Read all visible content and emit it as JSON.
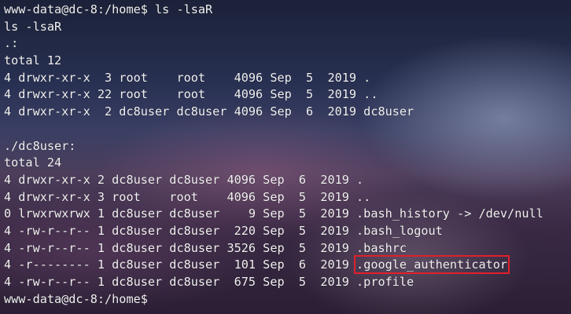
{
  "terminal": {
    "lines": [
      {
        "pre": "www-data@dc-8:/home$ ls -lsaR",
        "hl": "",
        "post": ""
      },
      {
        "pre": "ls -lsaR",
        "hl": "",
        "post": ""
      },
      {
        "pre": ".:",
        "hl": "",
        "post": ""
      },
      {
        "pre": "total 12",
        "hl": "",
        "post": ""
      },
      {
        "pre": "4 drwxr-xr-x  3 root    root    4096 Sep  5  2019 .",
        "hl": "",
        "post": ""
      },
      {
        "pre": "4 drwxr-xr-x 22 root    root    4096 Sep  5  2019 ..",
        "hl": "",
        "post": ""
      },
      {
        "pre": "4 drwxr-xr-x  2 dc8user dc8user 4096 Sep  6  2019 dc8user",
        "hl": "",
        "post": ""
      },
      {
        "pre": "",
        "hl": "",
        "post": ""
      },
      {
        "pre": "./dc8user:",
        "hl": "",
        "post": ""
      },
      {
        "pre": "total 24",
        "hl": "",
        "post": ""
      },
      {
        "pre": "4 drwxr-xr-x 2 dc8user dc8user 4096 Sep  6  2019 .",
        "hl": "",
        "post": ""
      },
      {
        "pre": "4 drwxr-xr-x 3 root    root    4096 Sep  5  2019 ..",
        "hl": "",
        "post": ""
      },
      {
        "pre": "0 lrwxrwxrwx 1 dc8user dc8user    9 Sep  5  2019 .bash_history -> /dev/null",
        "hl": "",
        "post": ""
      },
      {
        "pre": "4 -rw-r--r-- 1 dc8user dc8user  220 Sep  5  2019 .bash_logout",
        "hl": "",
        "post": ""
      },
      {
        "pre": "4 -rw-r--r-- 1 dc8user dc8user 3526 Sep  5  2019 .bashrc",
        "hl": "",
        "post": ""
      },
      {
        "pre": "4 -r-------- 1 dc8user dc8user  101 Sep  6  2019 ",
        "hl": ".google_authenticator",
        "post": ""
      },
      {
        "pre": "4 -rw-r--r-- 1 dc8user dc8user  675 Sep  5  2019 .profile",
        "hl": "",
        "post": ""
      },
      {
        "pre": "www-data@dc-8:/home$ ",
        "hl": "",
        "post": ""
      }
    ],
    "highlight_color": "#e0202a",
    "text_color": "#f2f2f2"
  }
}
